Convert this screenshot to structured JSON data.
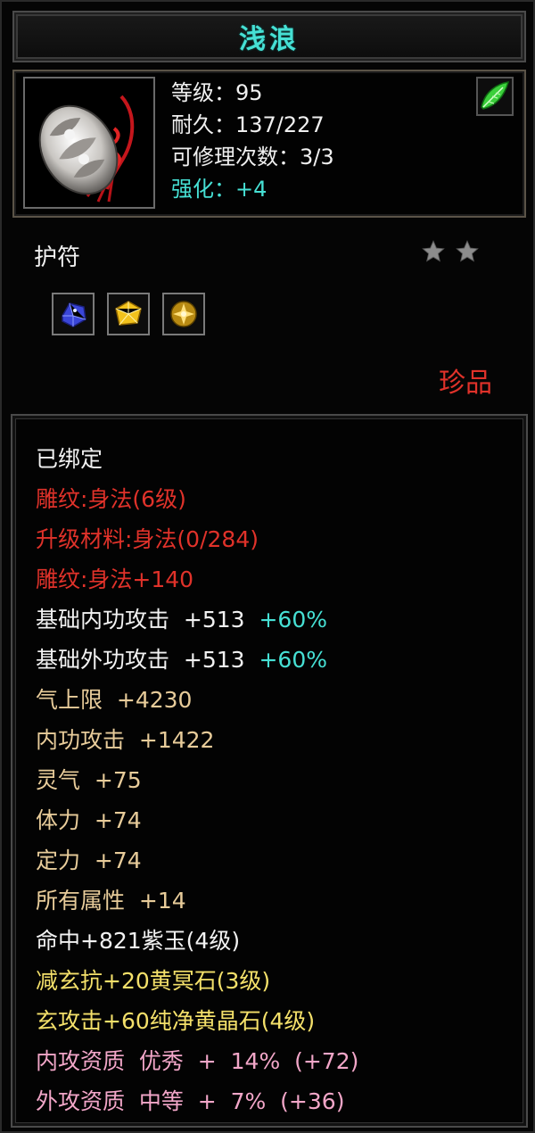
{
  "item": {
    "name": "浅浪",
    "level_text": "等级：95",
    "durability_text": "耐久：137/227",
    "repair_text": "可修理次数：3/3",
    "enhance_text": "强化：+4",
    "type": "护符",
    "star_count": 2,
    "rarity": "珍品"
  },
  "icons": {
    "item_icon": "jade-pendant-icon",
    "corner_icon": "green-leaf-icon",
    "star_icon": "star-icon",
    "gems": [
      "blue-gem-icon",
      "yellow-gem-icon",
      "gold-gem-icon"
    ]
  },
  "attributes": {
    "bound": "已绑定",
    "engrave": "雕纹:身法(6级)",
    "upgrade_material": "升级材料:身法(0/284)",
    "engrave_bonus": "雕纹:身法+140",
    "base_inner_attack": {
      "label": "基础内功攻击  +513",
      "pct": "+60%"
    },
    "base_outer_attack": {
      "label": "基础外功攻击  +513",
      "pct": "+60%"
    },
    "qi_limit": "气上限  +4230",
    "inner_attack": "内功攻击  +1422",
    "spirit": "灵气  +75",
    "stamina": "体力  +74",
    "focus": "定力  +74",
    "all_attrs": "所有属性  +14",
    "gem_hit": "命中+821紫玉(4级)",
    "gem_resist": "减玄抗+20黄冥石(3级)",
    "gem_attack": "玄攻击+60纯净黄晶石(4级)",
    "inner_quality": "内攻资质  优秀  +  14%  (+72)",
    "outer_quality": "外攻资质  中等  +  7%  (+36)"
  },
  "colors": {
    "title": "#46e0d4",
    "red": "#e0322a",
    "tan": "#e8cc9a",
    "cyan": "#46e0d4",
    "yellow": "#f4e06a",
    "pink": "#f2a6c8"
  }
}
